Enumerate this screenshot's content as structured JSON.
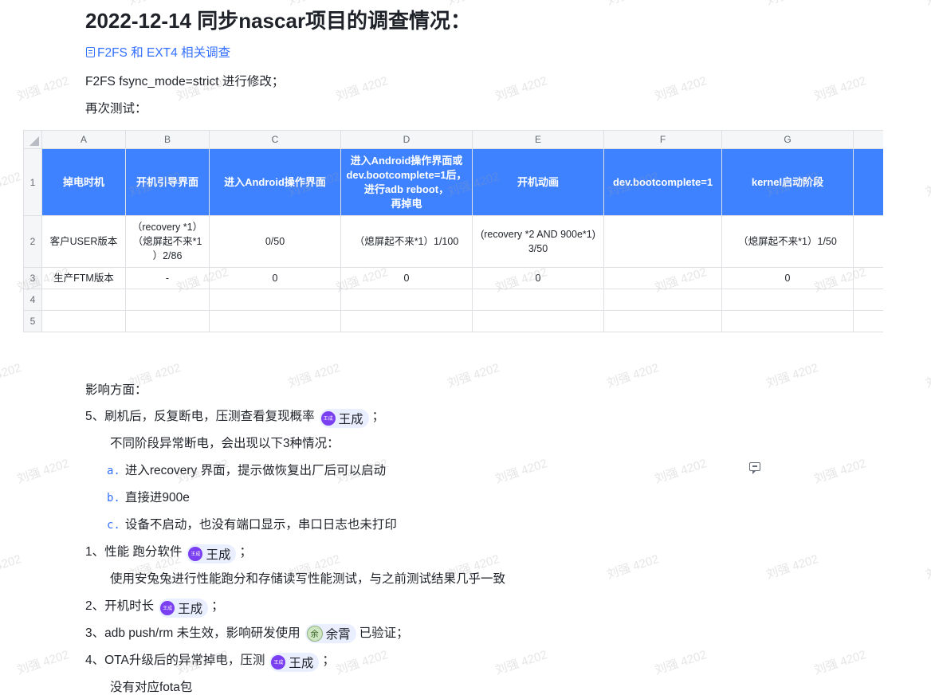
{
  "title": "2022-12-14 同步nascar项目的调查情况：",
  "doc_link": {
    "label": "F2FS 和 EXT4 相关调查"
  },
  "para_fsync": "F2FS fsync_mode=strict 进行修改；",
  "para_retest": "再次测试：",
  "sheet": {
    "col_letters": [
      "A",
      "B",
      "C",
      "D",
      "E",
      "F",
      "G"
    ],
    "row_numbers": [
      "1",
      "2",
      "3",
      "4",
      "5"
    ],
    "header_cells": [
      [
        "掉电时机"
      ],
      [
        "开机引导界面"
      ],
      [
        "进入Android操作界面"
      ],
      [
        "进入Android操作界面或",
        "dev.bootcomplete=1后，",
        "进行adb reboot，",
        "再掉电"
      ],
      [
        "开机动画"
      ],
      [
        "dev.bootcomplete=1"
      ],
      [
        "kernel启动阶段"
      ]
    ],
    "rows": [
      [
        [
          "客户USER版本"
        ],
        [
          "（recovery *1）",
          "（熄屏起不来*1",
          "）2/86"
        ],
        [
          "0/50"
        ],
        [
          "（熄屏起不来*1）1/100"
        ],
        [
          "(recovery *2 AND 900e*1)",
          "3/50"
        ],
        [
          ""
        ],
        [
          "（熄屏起不来*1）1/50"
        ]
      ],
      [
        [
          "生产FTM版本"
        ],
        [
          "-"
        ],
        [
          "0"
        ],
        [
          "0"
        ],
        [
          "0"
        ],
        [
          ""
        ],
        [
          "0"
        ]
      ],
      [
        [
          ""
        ],
        [
          ""
        ],
        [
          ""
        ],
        [
          ""
        ],
        [
          ""
        ],
        [
          ""
        ],
        [
          ""
        ]
      ],
      [
        [
          ""
        ],
        [
          ""
        ],
        [
          ""
        ],
        [
          ""
        ],
        [
          ""
        ],
        [
          ""
        ],
        [
          ""
        ]
      ]
    ]
  },
  "impact": {
    "heading": "影响方面：",
    "item5": {
      "text": "5、刷机后，反复断电，压测查看复现概率",
      "suffix": "；"
    },
    "item5_sub": "不同阶段异常断电，会出现以下3种情况：",
    "cases": [
      {
        "letter": "a.",
        "text": "进入recovery 界面，提示做恢复出厂后可以启动"
      },
      {
        "letter": "b.",
        "text": "直接进900e"
      },
      {
        "letter": "c.",
        "text": "设备不启动，也没有端口显示，串口日志也未打印"
      }
    ],
    "item1": {
      "text": "1、性能 跑分软件",
      "suffix": "；"
    },
    "item1_sub": "使用安兔兔进行性能跑分和存储读写性能测试，与之前测试结果几乎一致",
    "item2": {
      "text": "2、开机时长",
      "suffix": "；"
    },
    "item3": {
      "text": "3、adb push/rm 未生效，影响研发使用",
      "suffix": "已验证；"
    },
    "item4": {
      "text": "4、OTA升级后的异常掉电，压测",
      "suffix": "；"
    },
    "item4_sub": "没有对应fota包"
  },
  "mentions": {
    "wang": {
      "name": "王成",
      "avatar_text": "王成"
    },
    "yu": {
      "name": "余霄",
      "avatar_text": "余"
    }
  },
  "watermark_text": "刘强 4202",
  "colors": {
    "accent": "#3370ff",
    "table_header": "#3e82ff",
    "mention_bg": "#e9efff",
    "avatar": "#7b3ff2"
  }
}
